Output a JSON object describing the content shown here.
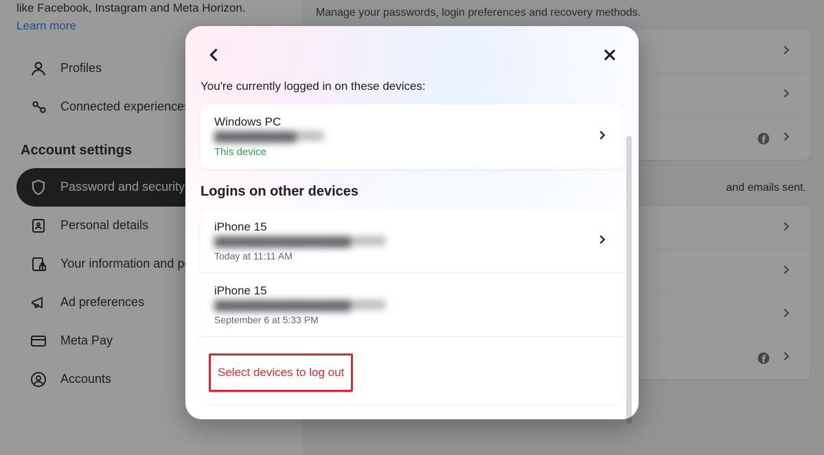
{
  "sidebar": {
    "intro": "like Facebook, Instagram and Meta Horizon.",
    "learn_more": "Learn more",
    "items": {
      "profiles": "Profiles",
      "connected": "Connected experiences"
    },
    "section_heading": "Account settings",
    "settings": {
      "password": "Password and security",
      "personal": "Personal details",
      "info_perms": "Your information and permissions",
      "ad_prefs": "Ad preferences",
      "meta_pay": "Meta Pay",
      "accounts": "Accounts"
    }
  },
  "main": {
    "subtitle": "Manage your passwords, login preferences and recovery methods.",
    "recent_text": "and emails sent."
  },
  "modal": {
    "intro": "You're currently logged in on these devices:",
    "current_device": {
      "name": "Windows PC",
      "location": "████████████",
      "badge": "This device"
    },
    "other_heading": "Logins on other devices",
    "other_devices": [
      {
        "name": "iPhone 15",
        "location": "████████████████████",
        "time": "Today at 11:11 AM"
      },
      {
        "name": "iPhone 15",
        "location": "████████████████████",
        "time": "September 6 at 5:33 PM"
      }
    ],
    "logout_label": "Select devices to log out"
  }
}
